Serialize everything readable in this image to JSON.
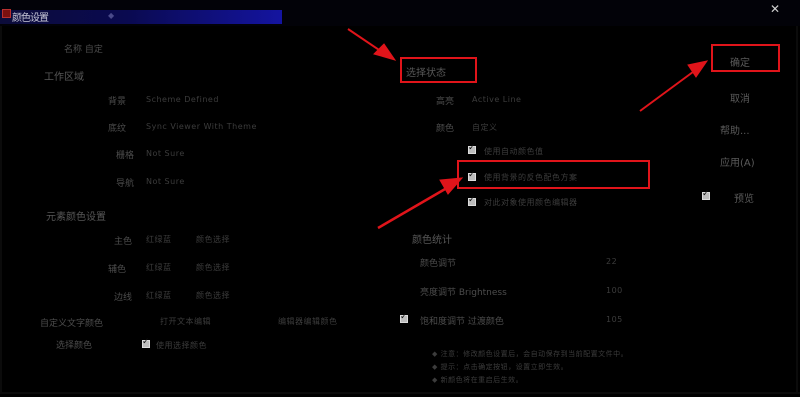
{
  "window": {
    "title": "颜色设置",
    "title_mark": "◆",
    "close_glyph": "✕"
  },
  "left": {
    "brand": "名称  自定",
    "work_area_label": "工作区域",
    "rows": [
      {
        "label": "背景",
        "value": "Scheme Defined"
      },
      {
        "label": "底纹",
        "value": "Sync Viewer With Theme"
      },
      {
        "label": "栅格",
        "value": "Not Sure"
      },
      {
        "label": "导航",
        "value": "Not Sure"
      }
    ],
    "color_section_label": "元素颜色设置",
    "color_rows": [
      {
        "label": "主色",
        "c1": "红绿蓝",
        "c2": "颜色选择"
      },
      {
        "label": "辅色",
        "c1": "红绿蓝",
        "c2": "颜色选择"
      },
      {
        "label": "边线",
        "c1": "红绿蓝",
        "c2": "颜色选择"
      }
    ],
    "custom_label": "自定义文字颜色",
    "custom_c1": "打开文本编辑",
    "custom_c2": "编辑器编辑颜色",
    "bottom_label": "选择颜色",
    "bottom_check_text": "使用选择颜色"
  },
  "middle": {
    "header": "选择状态",
    "rows": [
      {
        "label": "高亮",
        "value": "Active Line"
      },
      {
        "label": "颜色",
        "value": "自定义"
      }
    ],
    "checks": [
      {
        "text": "使用自动颜色值"
      },
      {
        "text": "使用背景的反色配色方案"
      },
      {
        "text": "对此对象使用颜色编辑器"
      }
    ],
    "stats_header": "颜色统计",
    "stats": [
      {
        "label": "颜色调节",
        "value": "22"
      },
      {
        "label": "亮度调节 Brightness",
        "value": "100"
      },
      {
        "label": "饱和度调节 过渡颜色",
        "value": "105"
      }
    ],
    "notes": [
      "◆ 注意：修改颜色设置后，会自动保存到当前配置文件中。",
      "◆ 提示：点击确定按钮，设置立即生效。",
      "◆ 新颜色将在重启后生效。"
    ]
  },
  "right": {
    "ok_label": "确定",
    "buttons": [
      "取消",
      "帮助...",
      "应用(A)"
    ],
    "check_label": "预览"
  },
  "colors": {
    "accent_red": "#e0141a",
    "title_blue": "#1414a0"
  }
}
